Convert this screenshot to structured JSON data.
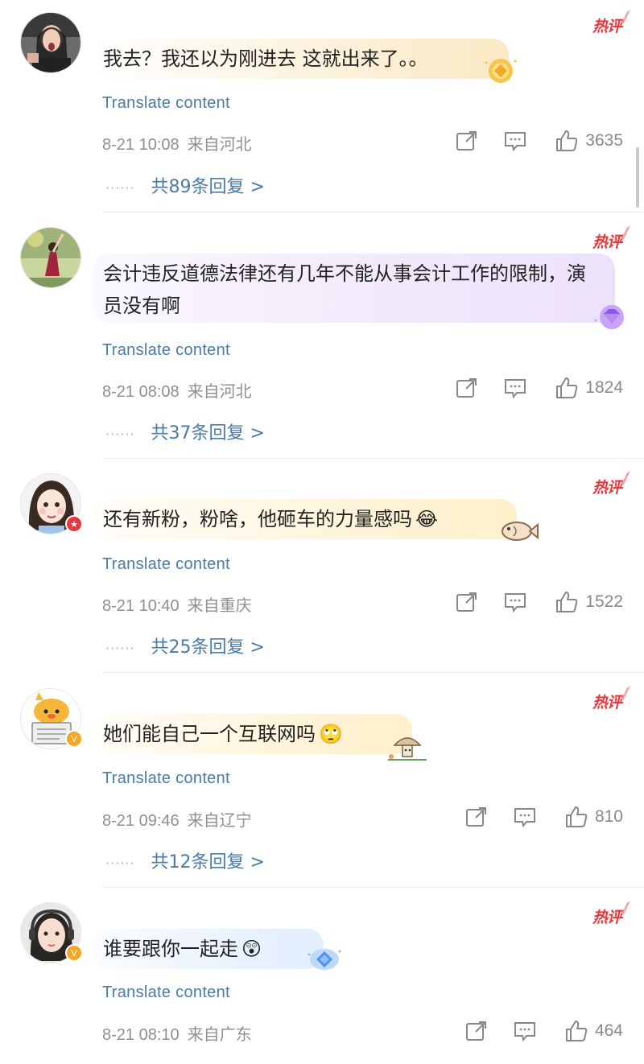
{
  "hot_label": "热评",
  "translate_label": "Translate content",
  "icons": {
    "share": "share-icon",
    "comment": "comment-icon",
    "like": "thumbs-up-icon"
  },
  "comments": [
    {
      "text": "我去？我还以为刚进去 这就出来了。。",
      "time": "8-21 10:08",
      "location": "来自河北",
      "likes": "3635",
      "replies": "共89条回复 >",
      "bubble_style": "gold",
      "badge": "none"
    },
    {
      "text": "会计违反道德法律还有几年不能从事会计工作的限制，演员没有啊",
      "time": "8-21 08:08",
      "location": "来自河北",
      "likes": "1824",
      "replies": "共37条回复 >",
      "bubble_style": "purple",
      "badge": "none"
    },
    {
      "text": "还有新粉，粉啥，他砸车的力量感吗",
      "emoji": "😂",
      "time": "8-21 10:40",
      "location": "来自重庆",
      "likes": "1522",
      "replies": "共25条回复 >",
      "bubble_style": "cream",
      "badge": "red-star"
    },
    {
      "text": "她们能自己一个互联网吗",
      "emoji": "🙄",
      "time": "8-21 09:46",
      "location": "来自辽宁",
      "likes": "810",
      "replies": "共12条回复 >",
      "bubble_style": "cream",
      "badge": "orange-v"
    },
    {
      "text": "谁要跟你一起走",
      "emoji": "😲",
      "time": "8-21 08:10",
      "location": "来自广东",
      "likes": "464",
      "bubble_style": "blue",
      "badge": "orange-v"
    }
  ],
  "colors": {
    "link_blue": "#4a7ba6",
    "hot_red": "#e8373b",
    "meta_gray": "#8f8f8f"
  }
}
